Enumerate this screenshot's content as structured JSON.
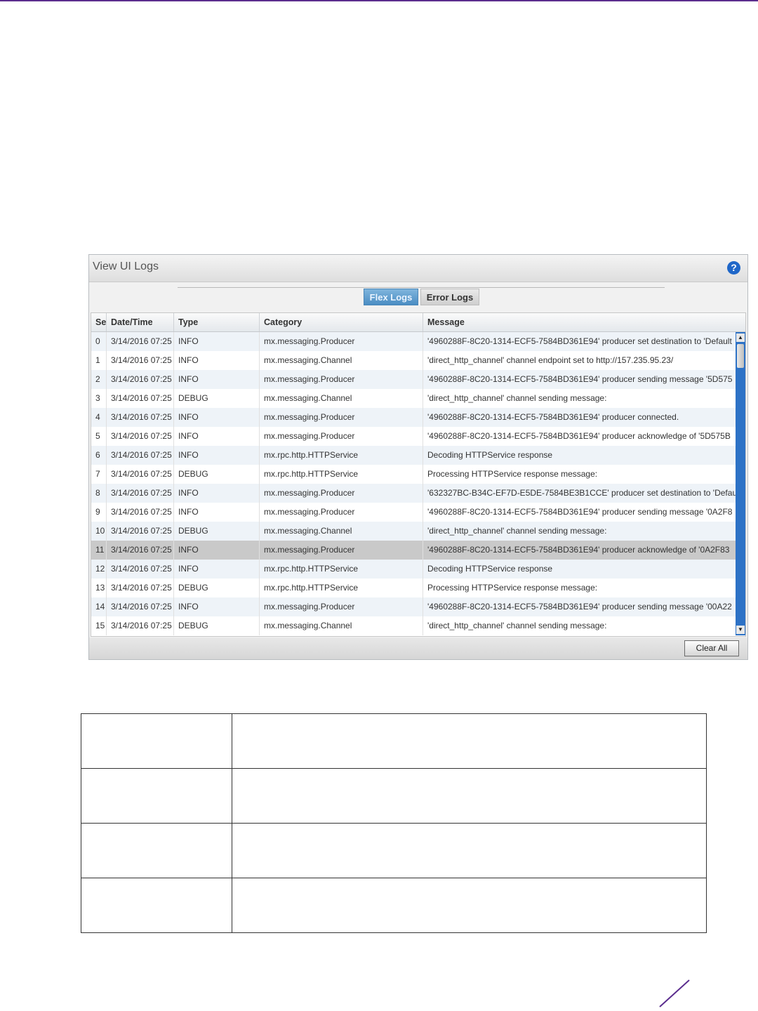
{
  "panel": {
    "title": "View UI Logs",
    "help_icon": "?",
    "tabs": [
      {
        "label": "Flex Logs",
        "active": true
      },
      {
        "label": "Error Logs",
        "active": false
      }
    ],
    "columns": [
      "Se",
      "Date/Time",
      "Type",
      "Category",
      "Message"
    ],
    "rows": [
      {
        "seq": "0",
        "datetime": "3/14/2016 07:25",
        "type": "INFO",
        "category": "mx.messaging.Producer",
        "message": "'4960288F-8C20-1314-ECF5-7584BD361E94' producer set destination to 'Default"
      },
      {
        "seq": "1",
        "datetime": "3/14/2016 07:25",
        "type": "INFO",
        "category": "mx.messaging.Channel",
        "message": "'direct_http_channel' channel endpoint set to http://157.235.95.23/"
      },
      {
        "seq": "2",
        "datetime": "3/14/2016 07:25",
        "type": "INFO",
        "category": "mx.messaging.Producer",
        "message": "'4960288F-8C20-1314-ECF5-7584BD361E94' producer sending message '5D575"
      },
      {
        "seq": "3",
        "datetime": "3/14/2016 07:25",
        "type": "DEBUG",
        "category": "mx.messaging.Channel",
        "message": "'direct_http_channel' channel sending message:"
      },
      {
        "seq": "4",
        "datetime": "3/14/2016 07:25",
        "type": "INFO",
        "category": "mx.messaging.Producer",
        "message": "'4960288F-8C20-1314-ECF5-7584BD361E94' producer connected."
      },
      {
        "seq": "5",
        "datetime": "3/14/2016 07:25",
        "type": "INFO",
        "category": "mx.messaging.Producer",
        "message": "'4960288F-8C20-1314-ECF5-7584BD361E94' producer acknowledge of '5D575B"
      },
      {
        "seq": "6",
        "datetime": "3/14/2016 07:25",
        "type": "INFO",
        "category": "mx.rpc.http.HTTPService",
        "message": "Decoding HTTPService response"
      },
      {
        "seq": "7",
        "datetime": "3/14/2016 07:25",
        "type": "DEBUG",
        "category": "mx.rpc.http.HTTPService",
        "message": "Processing HTTPService response message:"
      },
      {
        "seq": "8",
        "datetime": "3/14/2016 07:25",
        "type": "INFO",
        "category": "mx.messaging.Producer",
        "message": "'632327BC-B34C-EF7D-E5DE-7584BE3B1CCE' producer set destination to 'Defau"
      },
      {
        "seq": "9",
        "datetime": "3/14/2016 07:25",
        "type": "INFO",
        "category": "mx.messaging.Producer",
        "message": "'4960288F-8C20-1314-ECF5-7584BD361E94' producer sending message '0A2F8"
      },
      {
        "seq": "10",
        "datetime": "3/14/2016 07:25",
        "type": "DEBUG",
        "category": "mx.messaging.Channel",
        "message": "'direct_http_channel' channel sending message:"
      },
      {
        "seq": "11",
        "datetime": "3/14/2016 07:25",
        "type": "INFO",
        "category": "mx.messaging.Producer",
        "message": "'4960288F-8C20-1314-ECF5-7584BD361E94' producer acknowledge of '0A2F83"
      },
      {
        "seq": "12",
        "datetime": "3/14/2016 07:25",
        "type": "INFO",
        "category": "mx.rpc.http.HTTPService",
        "message": "Decoding HTTPService response"
      },
      {
        "seq": "13",
        "datetime": "3/14/2016 07:25",
        "type": "DEBUG",
        "category": "mx.rpc.http.HTTPService",
        "message": "Processing HTTPService response message:"
      },
      {
        "seq": "14",
        "datetime": "3/14/2016 07:25",
        "type": "INFO",
        "category": "mx.messaging.Producer",
        "message": "'4960288F-8C20-1314-ECF5-7584BD361E94' producer sending message '00A22"
      },
      {
        "seq": "15",
        "datetime": "3/14/2016 07:25",
        "type": "DEBUG",
        "category": "mx.messaging.Channel",
        "message": "'direct_http_channel' channel sending message:"
      }
    ],
    "selected_row": 11,
    "clear_button": "Clear All"
  },
  "colors": {
    "accent": "#5b2d8e",
    "tab_active": "#4b8dc3",
    "scrollbar": "#2d72c6",
    "help_icon": "#1e66c8"
  }
}
